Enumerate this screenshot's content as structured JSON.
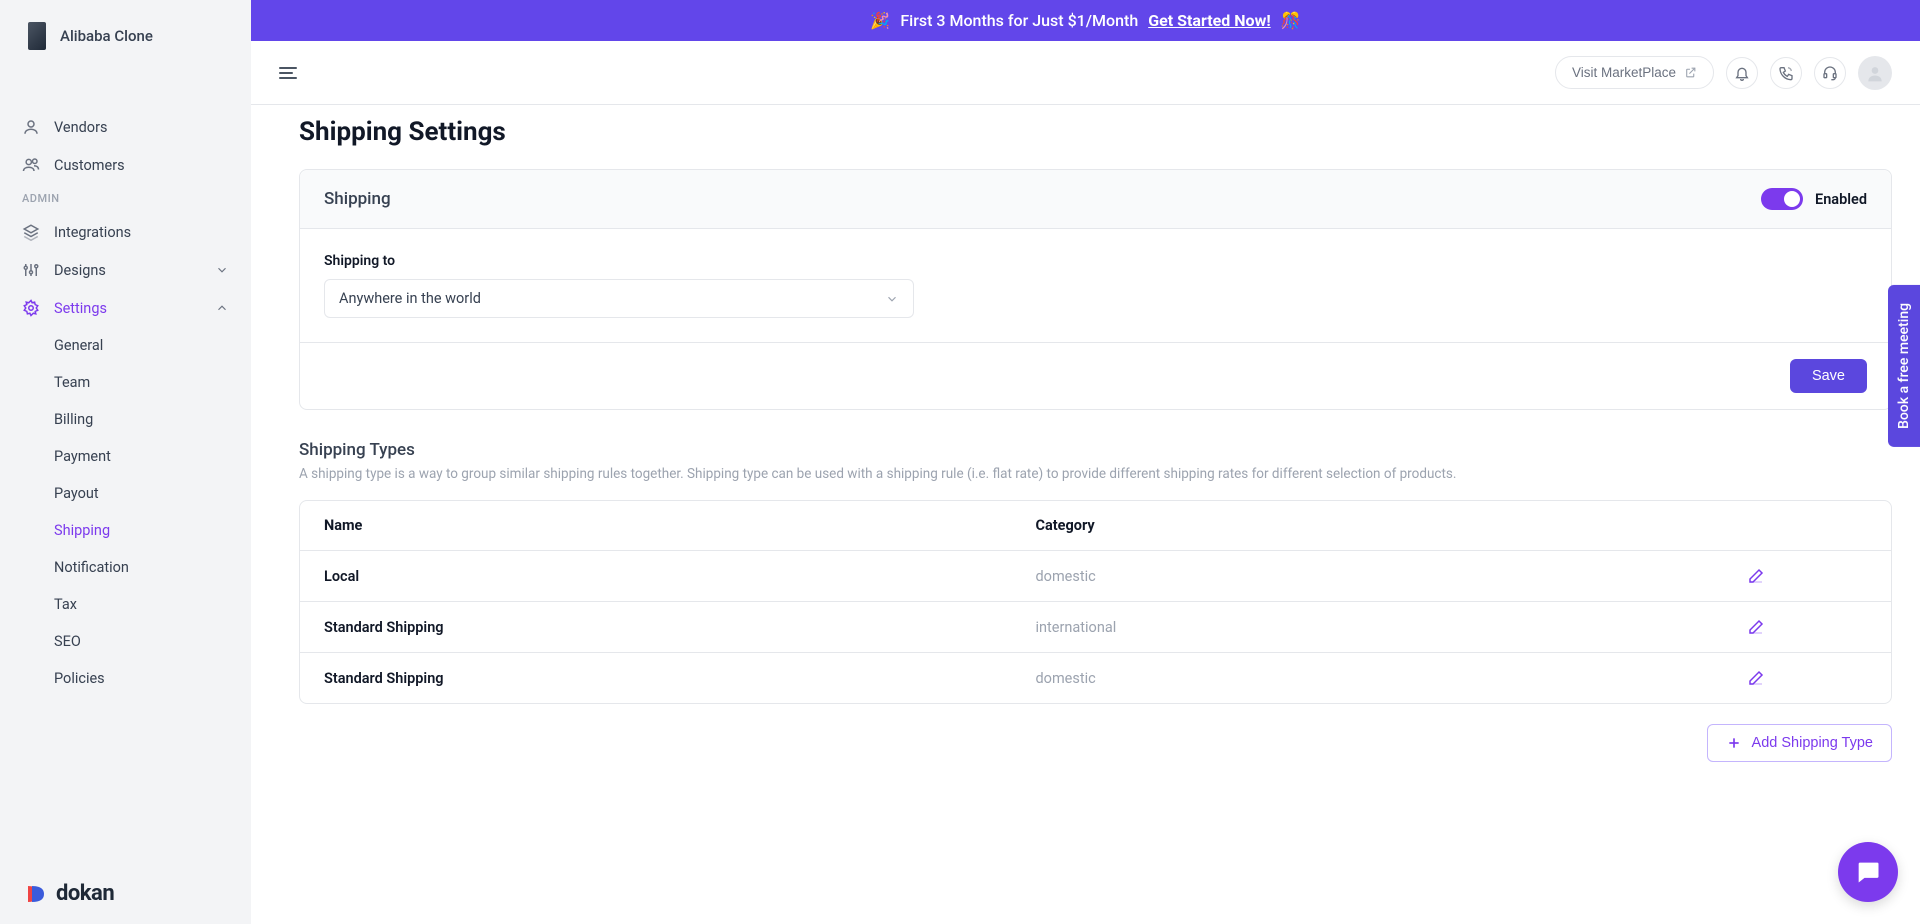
{
  "app": {
    "name": "Alibaba Clone",
    "brand": "dokan"
  },
  "promo": {
    "emoji_left": "🎉",
    "text": "First 3 Months for Just $1/Month",
    "cta": "Get Started Now!",
    "emoji_right": "🎊"
  },
  "topbar": {
    "visit": "Visit MarketPlace"
  },
  "sidebar": {
    "items_top": [
      {
        "label": "Vendors"
      },
      {
        "label": "Customers"
      }
    ],
    "admin_label": "ADMIN",
    "items_admin": [
      {
        "label": "Integrations"
      },
      {
        "label": "Designs"
      },
      {
        "label": "Settings"
      }
    ],
    "settings_sub": [
      {
        "label": "General"
      },
      {
        "label": "Team"
      },
      {
        "label": "Billing"
      },
      {
        "label": "Payment"
      },
      {
        "label": "Payout"
      },
      {
        "label": "Shipping"
      },
      {
        "label": "Notification"
      },
      {
        "label": "Tax"
      },
      {
        "label": "SEO"
      },
      {
        "label": "Policies"
      }
    ]
  },
  "page": {
    "title": "Shipping Settings",
    "card_title": "Shipping",
    "enabled_label": "Enabled",
    "shipping_to_label": "Shipping to",
    "shipping_to_value": "Anywhere in the world",
    "save": "Save",
    "types_title": "Shipping Types",
    "types_desc": "A shipping type is a way to group similar shipping rules together. Shipping type can be used with a shipping rule (i.e. flat rate) to provide different shipping rates for different selection of products.",
    "col_name": "Name",
    "col_category": "Category",
    "rows": [
      {
        "name": "Local",
        "category": "domestic"
      },
      {
        "name": "Standard Shipping",
        "category": "international"
      },
      {
        "name": "Standard Shipping",
        "category": "domestic"
      }
    ],
    "add_btn": "Add Shipping Type"
  },
  "side_tab": "Book a free meeting"
}
